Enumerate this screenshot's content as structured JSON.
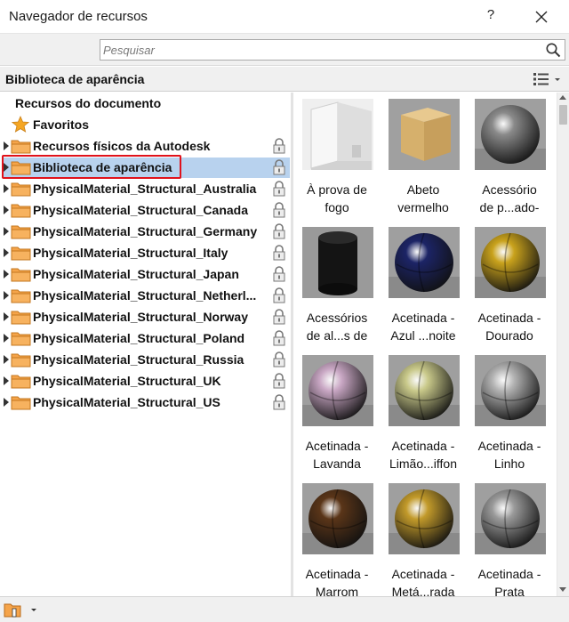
{
  "window": {
    "title": "Navegador de recursos",
    "help_label": "?"
  },
  "search": {
    "placeholder": "Pesquisar",
    "value": ""
  },
  "library_header": {
    "title": "Biblioteca de aparência"
  },
  "tree": {
    "items": [
      {
        "label": "Recursos do documento",
        "expandable": false,
        "folder": false,
        "locked": false
      },
      {
        "label": "Favoritos",
        "expandable": false,
        "folder": false,
        "icon": "star-icon",
        "locked": false
      },
      {
        "label": "Recursos físicos da Autodesk",
        "expandable": true,
        "folder": true,
        "locked": true
      },
      {
        "label": "Biblioteca de aparência",
        "expandable": true,
        "folder": true,
        "locked": true,
        "selected": true
      },
      {
        "label": "PhysicalMaterial_Structural_Australia",
        "expandable": true,
        "folder": true,
        "locked": true
      },
      {
        "label": "PhysicalMaterial_Structural_Canada",
        "expandable": true,
        "folder": true,
        "locked": true
      },
      {
        "label": "PhysicalMaterial_Structural_Germany",
        "expandable": true,
        "folder": true,
        "locked": true
      },
      {
        "label": "PhysicalMaterial_Structural_Italy",
        "expandable": true,
        "folder": true,
        "locked": true
      },
      {
        "label": "PhysicalMaterial_Structural_Japan",
        "expandable": true,
        "folder": true,
        "locked": true
      },
      {
        "label": "PhysicalMaterial_Structural_Netherl...",
        "expandable": true,
        "folder": true,
        "locked": true
      },
      {
        "label": "PhysicalMaterial_Structural_Norway",
        "expandable": true,
        "folder": true,
        "locked": true
      },
      {
        "label": "PhysicalMaterial_Structural_Poland",
        "expandable": true,
        "folder": true,
        "locked": true
      },
      {
        "label": "PhysicalMaterial_Structural_Russia",
        "expandable": true,
        "folder": true,
        "locked": true
      },
      {
        "label": "PhysicalMaterial_Structural_UK",
        "expandable": true,
        "folder": true,
        "locked": true
      },
      {
        "label": "PhysicalMaterial_Structural_US",
        "expandable": true,
        "folder": true,
        "locked": true
      }
    ]
  },
  "assets": [
    {
      "line1": "À prova de",
      "line2": "fogo",
      "thumb": "room",
      "color": "#e8e8e8"
    },
    {
      "line1": "Abeto",
      "line2": "vermelho",
      "thumb": "cube",
      "color": "#d9b579"
    },
    {
      "line1": "Acessório",
      "line2": "de p...ado-",
      "thumb": "sphere-chrome",
      "color": "#8a8a8a"
    },
    {
      "line1": "Acessórios",
      "line2": "de al...s de",
      "thumb": "cylinder",
      "color": "#1a1a1a"
    },
    {
      "line1": "Acetinada -",
      "line2": "Azul ...noite",
      "thumb": "sphere",
      "color": "#1c2466"
    },
    {
      "line1": "Acetinada -",
      "line2": "Dourado",
      "thumb": "sphere",
      "color": "#c9a21c"
    },
    {
      "line1": "Acetinada -",
      "line2": "Lavanda",
      "thumb": "sphere",
      "color": "#c9a7c4"
    },
    {
      "line1": "Acetinada -",
      "line2": "Limão...iffon",
      "thumb": "sphere",
      "color": "#c9c98a"
    },
    {
      "line1": "Acetinada -",
      "line2": "Linho",
      "thumb": "sphere",
      "color": "#b3b3b3"
    },
    {
      "line1": "Acetinada -",
      "line2": "Marrom",
      "thumb": "sphere",
      "color": "#5a3518"
    },
    {
      "line1": "Acetinada -",
      "line2": "Metá...rada",
      "thumb": "sphere",
      "color": "#c29a2a"
    },
    {
      "line1": "Acetinada -",
      "line2": "Prata",
      "thumb": "sphere",
      "color": "#9a9a9a"
    }
  ],
  "colors": {
    "selection": "#b8d2ee",
    "highlight": "#e0121b",
    "folder": "#f5a44a"
  }
}
